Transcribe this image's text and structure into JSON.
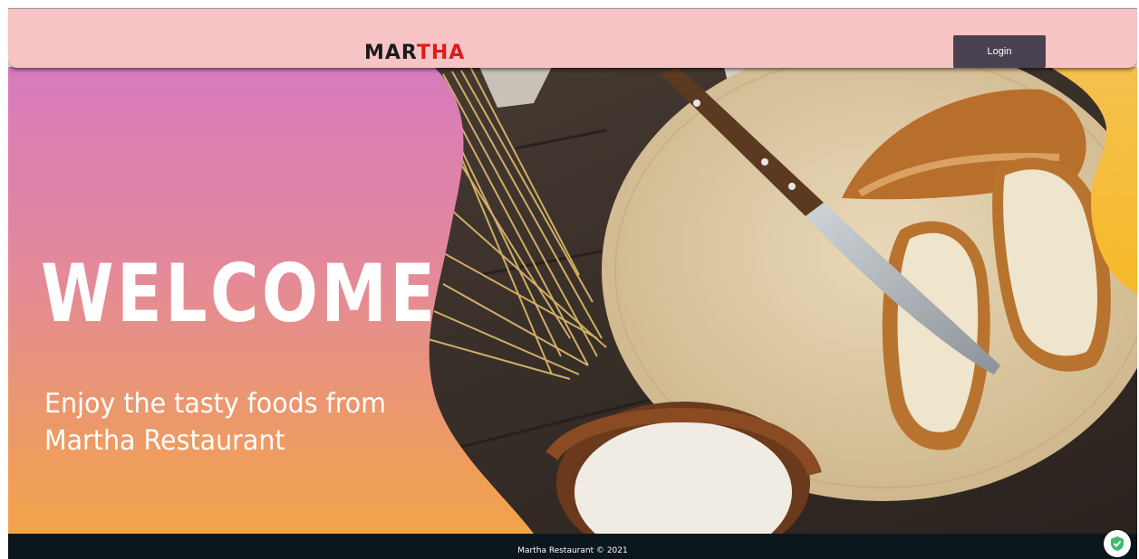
{
  "header": {
    "brand_part1": "MAR",
    "brand_part2": "THA",
    "login_label": "Login"
  },
  "hero": {
    "headline": "WELCOME",
    "tagline_line1": "Enjoy the tasty foods from",
    "tagline_line2": "Martha Restaurant"
  },
  "footer": {
    "text": "Martha Restaurant © 2021"
  },
  "colors": {
    "header_bg": "#f6c4c4",
    "brand_dark": "#1b1b1b",
    "brand_red": "#e01b1b",
    "login_bg": "#4a4150",
    "gradient_top": "#d97ab8",
    "gradient_bottom": "#f0a24a",
    "footer_bg": "#0b171c"
  },
  "icons": {
    "badge": "shield-check-icon"
  }
}
